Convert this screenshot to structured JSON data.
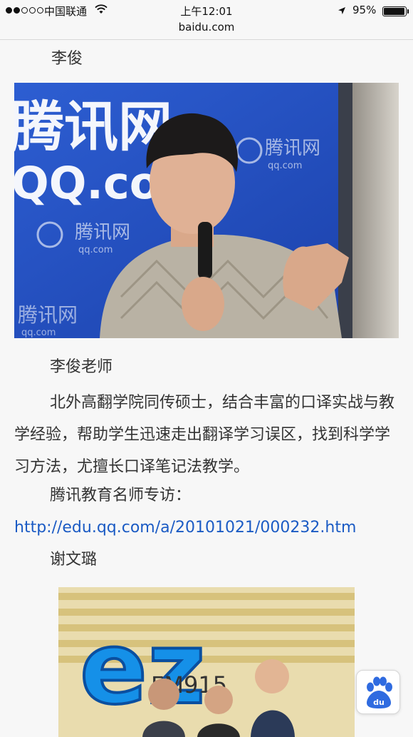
{
  "status_bar": {
    "carrier": "中国联通",
    "time": "上午12:01",
    "battery": "95%",
    "battery_level": 0.95,
    "url": "baidu.com"
  },
  "article": {
    "name1": "李俊",
    "photo1_logos": {
      "big": "腾讯网",
      "qq_big": "QQ.com",
      "logo_text": "腾讯网",
      "logo_sub": "qq.com"
    },
    "caption1": "李俊老师",
    "paragraph1": "北外高翻学院同传硕士，结合丰富的口译实战与教学经验，帮助学生迅速走出翻译学习误区，找到科学学习方法，尤擅长口译笔记法教学。",
    "interview_label": "腾讯教育名师专访：",
    "interview_link": "http://edu.qq.com/a/20101021/000232.htm",
    "name2": "谢文璐",
    "photo2_sign": "FM915"
  },
  "colors": {
    "link": "#1b5bc4",
    "banner_blue": "#1f4fc6",
    "baidu_blue": "#2f6be0"
  },
  "icons": [
    "wifi-icon",
    "location-arrow-icon",
    "battery-icon",
    "baidu-paw-icon"
  ]
}
